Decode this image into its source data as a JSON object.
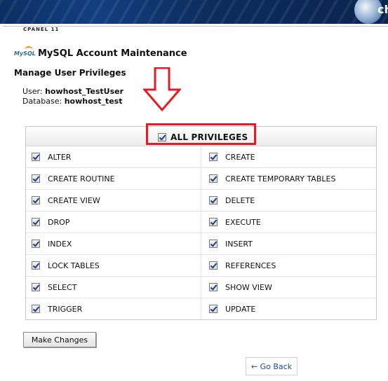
{
  "banner": {
    "logo_text": "ch"
  },
  "subbar": {
    "label": "CPANEL 11"
  },
  "header": {
    "icon_text": "MySQL",
    "title": "MySQL Account Maintenance"
  },
  "section": {
    "title": "Manage User Privileges"
  },
  "info": {
    "user_label": "User:",
    "user_value": "howhost_TestUser",
    "database_label": "Database:",
    "database_value": "howhost_test"
  },
  "all_privileges": {
    "label": "ALL PRIVILEGES",
    "checked": true
  },
  "privileges": {
    "left": [
      "ALTER",
      "CREATE ROUTINE",
      "CREATE VIEW",
      "DROP",
      "INDEX",
      "LOCK TABLES",
      "SELECT",
      "TRIGGER"
    ],
    "right": [
      "CREATE",
      "CREATE TEMPORARY TABLES",
      "DELETE",
      "EXECUTE",
      "INSERT",
      "REFERENCES",
      "SHOW VIEW",
      "UPDATE"
    ]
  },
  "buttons": {
    "make_changes": "Make Changes",
    "go_back": "← Go Back"
  },
  "colors": {
    "highlight": "#e41b23",
    "link": "#1a4aa3",
    "banner": "#0b2f63"
  },
  "icons": [
    "mysql-logo-icon",
    "down-arrow-annotation-icon",
    "checkbox-checked-icon"
  ]
}
